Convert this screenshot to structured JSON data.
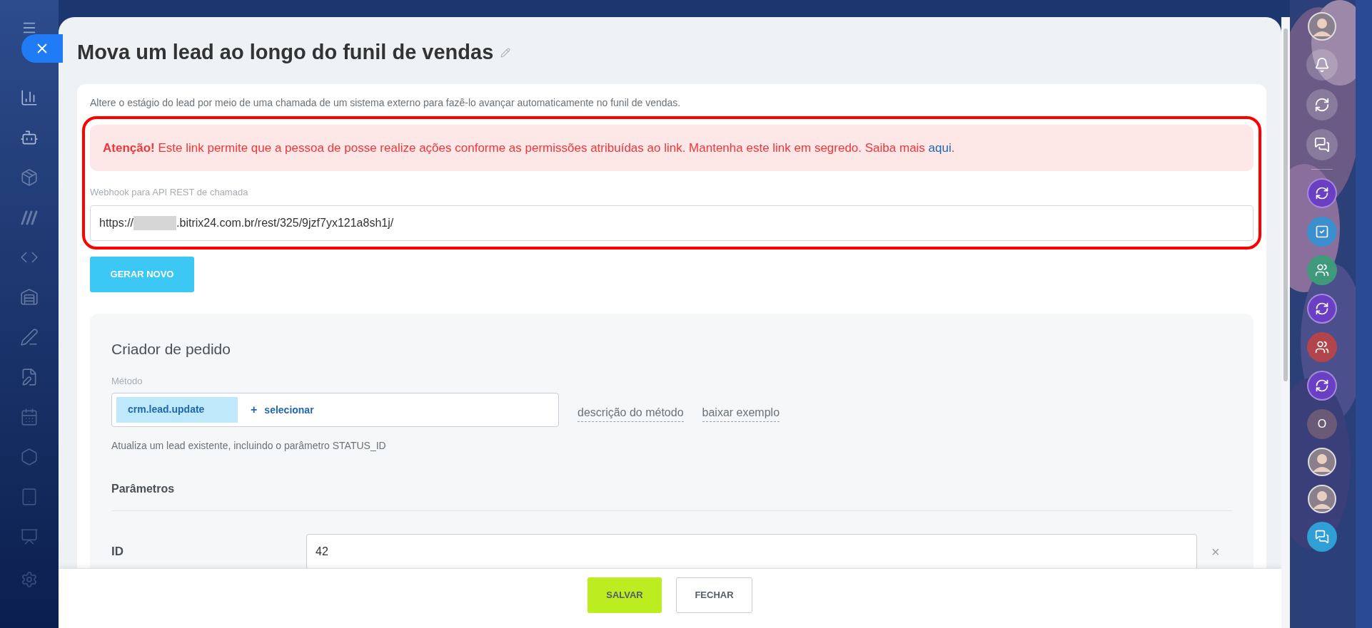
{
  "title": "Mova um lead ao longo do funil de vendas",
  "description": "Altere o estágio do lead por meio de uma chamada de um sistema externo para fazê-lo avançar automaticamente no funil de vendas.",
  "alert": {
    "text": "**Atenção!** Este link permite que a pessoa de posse realize ações conforme as permissões atribuídas ao link. Mantenha este link em segredo. Saiba mais",
    "link": "aqui",
    "end": "."
  },
  "webhook": {
    "label": "Webhook para API REST de chamada",
    "value_start": "https://",
    "value_end": ".bitrix24.com.br/rest/325/9jzf7yx121a8sh1j/"
  },
  "generate_button": "GERAR NOVO",
  "builder": {
    "title": "Criador de pedido",
    "method_label": "Método",
    "method_tag": "crm.lead.update",
    "select_plus": "+",
    "select_label": "selecionar",
    "links": [
      "descrição do método",
      "baixar exemplo"
    ],
    "method_note": "Atualiza um lead existente, incluindo o parâmetro STATUS_ID",
    "params_title": "Parâmetros",
    "params": [
      {
        "name": "ID",
        "value": "42",
        "remove": "×"
      }
    ]
  },
  "footer_buttons": [
    {
      "label": "SALVAR",
      "kind": "primary"
    },
    {
      "label": "FECHAR",
      "kind": "secondary"
    }
  ],
  "right_bar": [
    {
      "kind": "avatar"
    },
    {
      "kind": "bell"
    },
    {
      "kind": "sync"
    },
    {
      "kind": "chat"
    },
    {
      "kind": "divider"
    },
    {
      "kind": "openline",
      "color": "#6a3fc4"
    },
    {
      "kind": "task",
      "color": "#3b8fcf"
    },
    {
      "kind": "group",
      "color": "#3e9a7a"
    },
    {
      "kind": "openline",
      "color": "#6a3fc4"
    },
    {
      "kind": "group",
      "color": "#b2454c"
    },
    {
      "kind": "openline",
      "color": "#6a3fc4"
    },
    {
      "kind": "letter",
      "color": "#6a5a78",
      "letter": "O"
    },
    {
      "kind": "avatar"
    },
    {
      "kind": "avatar"
    },
    {
      "kind": "message",
      "color": "#2f9fd6"
    }
  ]
}
